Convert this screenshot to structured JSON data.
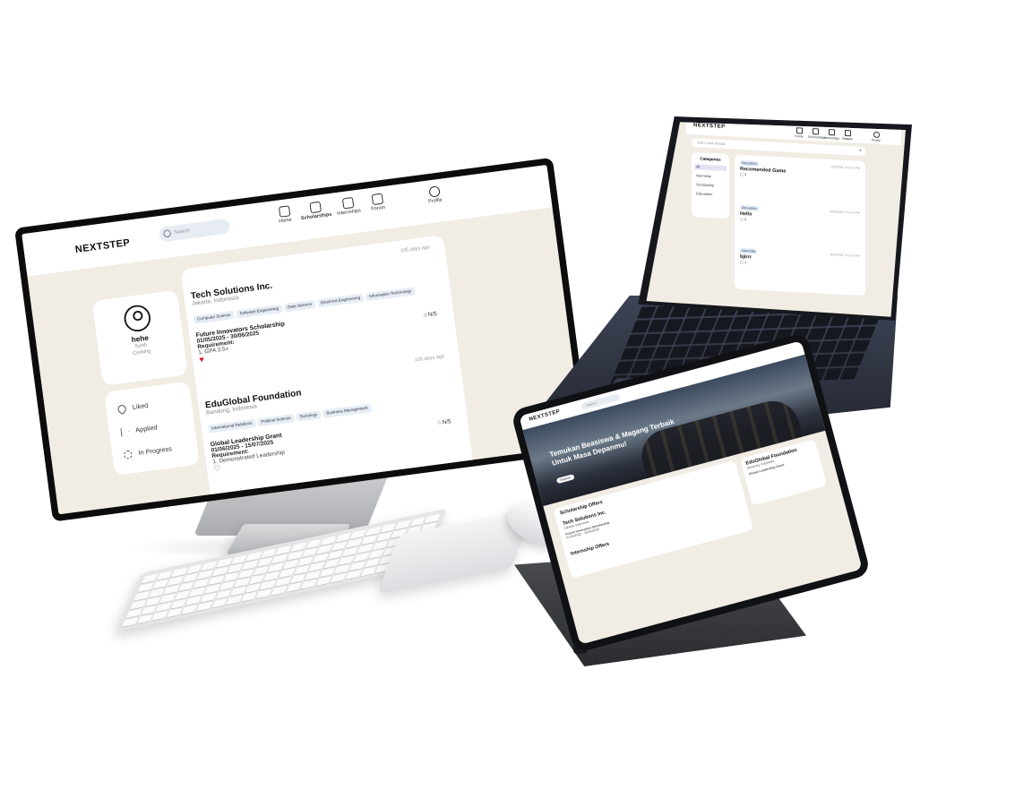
{
  "monitor": {
    "brand": "NEXTSTEP",
    "search_placeholder": "Search",
    "nav": [
      {
        "label": "Home",
        "icon": "home-icon"
      },
      {
        "label": "Scholarships",
        "icon": "graduation-cap-icon"
      },
      {
        "label": "Internships",
        "icon": "briefcase-icon"
      },
      {
        "label": "Forum",
        "icon": "chat-icon"
      }
    ],
    "profile_label": "Profile",
    "profile": {
      "name": "hehe",
      "line1": "Sunib",
      "line2": "Cooking"
    },
    "menu": [
      {
        "label": "Liked",
        "icon": "heart-icon"
      },
      {
        "label": "Applied",
        "icon": "send-icon"
      },
      {
        "label": "In Progress",
        "icon": "loader-icon"
      }
    ],
    "cards": [
      {
        "ago": "105 days ago",
        "org": "Tech Solutions Inc.",
        "location": "Jakarta, Indonesia",
        "tags": [
          "Computer Science",
          "Software Engineering",
          "Data Science",
          "Electrical Engineering",
          "Information Technology"
        ],
        "program": "Future Innovators Scholarship",
        "dates": "01/05/2025 - 30/06/2025",
        "req_label": "Requirement:",
        "req_item": "1. GPA 3.5+",
        "rating": "N/5",
        "liked": true
      },
      {
        "ago": "105 days ago",
        "org": "EduGlobal Foundation",
        "location": "Bandung, Indonesia",
        "tags": [
          "International Relations",
          "Political Science",
          "Sociology",
          "Business Management"
        ],
        "program": "Global Leadership Grant",
        "dates": "01/06/2025 - 15/07/2025",
        "req_label": "Requirement:",
        "req_item": "1. Demonstrated Leadership",
        "rating": "N/5",
        "liked": false
      }
    ]
  },
  "laptop": {
    "brand": "NEXTSTEP",
    "nav": [
      "Home",
      "Scholarships",
      "Internships",
      "Forum",
      "Profile"
    ],
    "new_thread_placeholder": "Add a new thread",
    "categories_title": "Categories",
    "categories": [
      "All",
      "Internship",
      "Scholarship",
      "Discussion"
    ],
    "posts": [
      {
        "badge": "Discussion",
        "title": "Recomended Game",
        "date": "7/28/2025, 3:14:31 PM",
        "count": "3"
      },
      {
        "badge": "Discussion",
        "title": "Hello",
        "date": "6/26/2025, 3:14:31 PM",
        "count": "0"
      },
      {
        "badge": "Internship",
        "title": "bjirrr",
        "date": "6/26/2025, 3:14:31 PM",
        "count": "1"
      }
    ]
  },
  "tablet": {
    "brand": "NEXTSTEP",
    "search_placeholder": "Search",
    "hero_text": "Temukan Beasiswa & Magang Terbaik Untuk Masa Depanmu!",
    "hero_button": "Explore",
    "section_scholarship": "Scholarship Offers",
    "card_org": "Tech Solutions Inc.",
    "card_location": "Jakarta, Indonesia",
    "card_program": "Future Innovators Scholarship",
    "card_dates": "01/05/2025 - 30/06/2025",
    "side_org": "EduGlobal Foundation",
    "side_location": "Bandung, Indonesia",
    "side_program": "Global Leadership Grant",
    "section_internship": "Internship Offers"
  }
}
